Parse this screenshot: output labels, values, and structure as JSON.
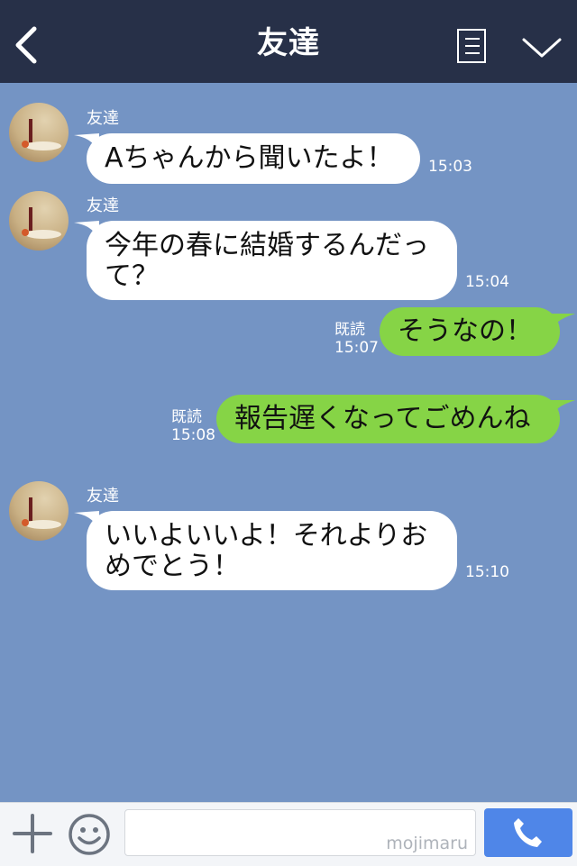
{
  "header": {
    "title": "友達"
  },
  "messages": [
    {
      "side": "in",
      "sender": "友達",
      "text": "Aちゃんから聞いたよ！",
      "time": "15:03"
    },
    {
      "side": "in",
      "sender": "友達",
      "text": "今年の春に結婚するんだって？",
      "time": "15:04"
    },
    {
      "side": "out",
      "read": "既読",
      "text": "そうなの！",
      "time": "15:07"
    },
    {
      "side": "out",
      "read": "既読",
      "text": "報告遅くなってごめんね",
      "time": "15:08"
    },
    {
      "side": "in",
      "sender": "友達",
      "text": "いいよいいよ！それよりおめでとう！",
      "time": "15:10"
    }
  ],
  "footer": {
    "watermark": "mojimaru"
  },
  "icons": {
    "back": "chevron-left-icon",
    "menu": "list-icon",
    "collapse": "chevron-down-icon",
    "add": "plus-icon",
    "emoji": "smile-icon",
    "call": "phone-icon"
  },
  "colors": {
    "header": "#273048",
    "chat_background": "#7494c4",
    "incoming_bubble": "#ffffff",
    "outgoing_bubble": "#86d446",
    "call_button": "#4f86e8"
  }
}
